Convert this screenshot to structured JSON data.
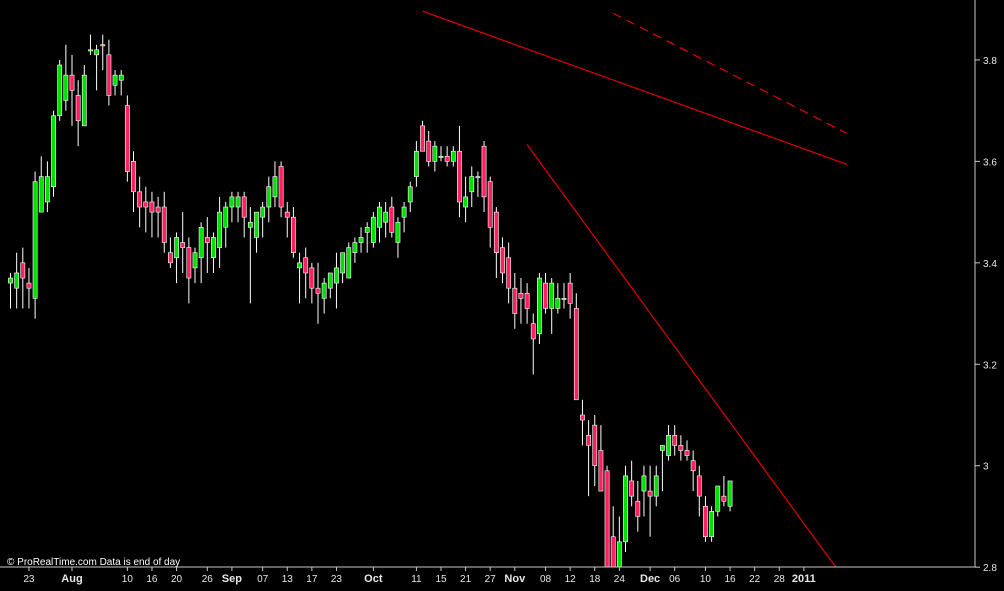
{
  "watermark": "© ProRealTime.com  Data is end of day",
  "chart_data": {
    "type": "candlestick",
    "grid": false,
    "ylim": [
      2.7,
      3.9
    ],
    "y_ticks": [
      2.8,
      3.0,
      3.2,
      3.4,
      3.6,
      3.8
    ],
    "y_tick_labels": [
      "2.8",
      "3",
      "3.2",
      "3.4",
      "3.6",
      "3.8"
    ],
    "x_ticks": [
      {
        "i": 3,
        "label": "23",
        "bold": false
      },
      {
        "i": 10,
        "label": "Aug",
        "bold": true
      },
      {
        "i": 19,
        "label": "10",
        "bold": false
      },
      {
        "i": 23,
        "label": "16",
        "bold": false
      },
      {
        "i": 27,
        "label": "20",
        "bold": false
      },
      {
        "i": 32,
        "label": "26",
        "bold": false
      },
      {
        "i": 36,
        "label": "Sep",
        "bold": true
      },
      {
        "i": 41,
        "label": "07",
        "bold": false
      },
      {
        "i": 45,
        "label": "13",
        "bold": false
      },
      {
        "i": 49,
        "label": "17",
        "bold": false
      },
      {
        "i": 53,
        "label": "23",
        "bold": false
      },
      {
        "i": 59,
        "label": "Oct",
        "bold": true
      },
      {
        "i": 66,
        "label": "11",
        "bold": false
      },
      {
        "i": 70,
        "label": "15",
        "bold": false
      },
      {
        "i": 74,
        "label": "21",
        "bold": false
      },
      {
        "i": 78,
        "label": "27",
        "bold": false
      },
      {
        "i": 82,
        "label": "Nov",
        "bold": true
      },
      {
        "i": 87,
        "label": "08",
        "bold": false
      },
      {
        "i": 91,
        "label": "12",
        "bold": false
      },
      {
        "i": 95,
        "label": "18",
        "bold": false
      },
      {
        "i": 99,
        "label": "24",
        "bold": false
      },
      {
        "i": 104,
        "label": "Dec",
        "bold": true
      },
      {
        "i": 108,
        "label": "06",
        "bold": false
      },
      {
        "i": 113,
        "label": "10",
        "bold": false
      },
      {
        "i": 117,
        "label": "16",
        "bold": false
      },
      {
        "i": 121,
        "label": "22",
        "bold": false
      },
      {
        "i": 125,
        "label": "28",
        "bold": false
      },
      {
        "i": 129,
        "label": "2011",
        "bold": true
      }
    ],
    "candles": [
      [
        3.36,
        3.38,
        3.31,
        3.37
      ],
      [
        3.35,
        3.42,
        3.31,
        3.38
      ],
      [
        3.4,
        3.43,
        3.31,
        3.37
      ],
      [
        3.36,
        3.39,
        3.31,
        3.35
      ],
      [
        3.33,
        3.58,
        3.29,
        3.56
      ],
      [
        3.5,
        3.61,
        3.5,
        3.57
      ],
      [
        3.52,
        3.6,
        3.5,
        3.57
      ],
      [
        3.55,
        3.7,
        3.53,
        3.69
      ],
      [
        3.69,
        3.8,
        3.68,
        3.79
      ],
      [
        3.72,
        3.83,
        3.7,
        3.77
      ],
      [
        3.77,
        3.81,
        3.67,
        3.74
      ],
      [
        3.73,
        3.76,
        3.63,
        3.68
      ],
      [
        3.67,
        3.79,
        3.67,
        3.77
      ],
      [
        3.82,
        3.85,
        3.81,
        3.82
      ],
      [
        3.81,
        3.83,
        3.74,
        3.82
      ],
      [
        3.83,
        3.85,
        3.78,
        3.83
      ],
      [
        3.81,
        3.84,
        3.71,
        3.73
      ],
      [
        3.75,
        3.78,
        3.73,
        3.77
      ],
      [
        3.76,
        3.78,
        3.73,
        3.77
      ],
      [
        3.71,
        3.73,
        3.56,
        3.58
      ],
      [
        3.6,
        3.62,
        3.5,
        3.54
      ],
      [
        3.54,
        3.57,
        3.47,
        3.51
      ],
      [
        3.52,
        3.55,
        3.46,
        3.51
      ],
      [
        3.52,
        3.54,
        3.45,
        3.5
      ],
      [
        3.51,
        3.53,
        3.45,
        3.5
      ],
      [
        3.51,
        3.54,
        3.42,
        3.44
      ],
      [
        3.42,
        3.45,
        3.39,
        3.4
      ],
      [
        3.41,
        3.46,
        3.36,
        3.45
      ],
      [
        3.44,
        3.5,
        3.38,
        3.43
      ],
      [
        3.43,
        3.45,
        3.32,
        3.37
      ],
      [
        3.39,
        3.43,
        3.36,
        3.42
      ],
      [
        3.41,
        3.48,
        3.36,
        3.47
      ],
      [
        3.45,
        3.49,
        3.38,
        3.44
      ],
      [
        3.41,
        3.46,
        3.38,
        3.45
      ],
      [
        3.43,
        3.53,
        3.39,
        3.5
      ],
      [
        3.47,
        3.52,
        3.43,
        3.51
      ],
      [
        3.51,
        3.54,
        3.48,
        3.53
      ],
      [
        3.51,
        3.54,
        3.48,
        3.53
      ],
      [
        3.53,
        3.54,
        3.45,
        3.49
      ],
      [
        3.47,
        3.51,
        3.32,
        3.48
      ],
      [
        3.45,
        3.5,
        3.42,
        3.5
      ],
      [
        3.49,
        3.52,
        3.45,
        3.51
      ],
      [
        3.51,
        3.57,
        3.48,
        3.55
      ],
      [
        3.53,
        3.6,
        3.51,
        3.57
      ],
      [
        3.59,
        3.6,
        3.49,
        3.51
      ],
      [
        3.5,
        3.52,
        3.45,
        3.49
      ],
      [
        3.49,
        3.51,
        3.41,
        3.42
      ],
      [
        3.39,
        3.42,
        3.32,
        3.4
      ],
      [
        3.41,
        3.43,
        3.33,
        3.38
      ],
      [
        3.39,
        3.4,
        3.32,
        3.35
      ],
      [
        3.35,
        3.4,
        3.28,
        3.34
      ],
      [
        3.33,
        3.37,
        3.3,
        3.36
      ],
      [
        3.35,
        3.38,
        3.33,
        3.38
      ],
      [
        3.36,
        3.42,
        3.31,
        3.39
      ],
      [
        3.38,
        3.42,
        3.36,
        3.42
      ],
      [
        3.37,
        3.44,
        3.37,
        3.43
      ],
      [
        3.42,
        3.45,
        3.4,
        3.44
      ],
      [
        3.44,
        3.47,
        3.42,
        3.45
      ],
      [
        3.46,
        3.48,
        3.42,
        3.47
      ],
      [
        3.44,
        3.5,
        3.43,
        3.49
      ],
      [
        3.47,
        3.52,
        3.44,
        3.51
      ],
      [
        3.48,
        3.52,
        3.45,
        3.5
      ],
      [
        3.51,
        3.53,
        3.45,
        3.46
      ],
      [
        3.44,
        3.49,
        3.41,
        3.48
      ],
      [
        3.49,
        3.52,
        3.46,
        3.51
      ],
      [
        3.52,
        3.56,
        3.5,
        3.55
      ],
      [
        3.57,
        3.64,
        3.55,
        3.62
      ],
      [
        3.67,
        3.68,
        3.62,
        3.62
      ],
      [
        3.64,
        3.66,
        3.59,
        3.6
      ],
      [
        3.6,
        3.64,
        3.58,
        3.63
      ],
      [
        3.61,
        3.63,
        3.6,
        3.61
      ],
      [
        3.61,
        3.63,
        3.59,
        3.6
      ],
      [
        3.6,
        3.63,
        3.59,
        3.62
      ],
      [
        3.62,
        3.67,
        3.49,
        3.52
      ],
      [
        3.51,
        3.57,
        3.48,
        3.53
      ],
      [
        3.54,
        3.59,
        3.51,
        3.57
      ],
      [
        3.57,
        3.58,
        3.53,
        3.57
      ],
      [
        3.63,
        3.64,
        3.5,
        3.53
      ],
      [
        3.56,
        3.57,
        3.43,
        3.47
      ],
      [
        3.5,
        3.51,
        3.37,
        3.42
      ],
      [
        3.43,
        3.45,
        3.36,
        3.38
      ],
      [
        3.41,
        3.44,
        3.32,
        3.35
      ],
      [
        3.35,
        3.38,
        3.27,
        3.3
      ],
      [
        3.34,
        3.37,
        3.28,
        3.33
      ],
      [
        3.34,
        3.36,
        3.28,
        3.31
      ],
      [
        3.28,
        3.3,
        3.18,
        3.25
      ],
      [
        3.26,
        3.38,
        3.24,
        3.37
      ],
      [
        3.36,
        3.38,
        3.3,
        3.31
      ],
      [
        3.31,
        3.37,
        3.26,
        3.36
      ],
      [
        3.31,
        3.36,
        3.3,
        3.33
      ],
      [
        3.33,
        3.36,
        3.31,
        3.33
      ],
      [
        3.36,
        3.38,
        3.29,
        3.32
      ],
      [
        3.31,
        3.34,
        3.13,
        3.13
      ],
      [
        3.1,
        3.13,
        3.04,
        3.09
      ],
      [
        3.06,
        3.09,
        2.94,
        3.04
      ],
      [
        3.08,
        3.1,
        2.96,
        3.0
      ],
      [
        3.03,
        3.08,
        2.95,
        2.95
      ],
      [
        2.99,
        3.0,
        2.75,
        2.76
      ],
      [
        2.86,
        2.92,
        2.77,
        2.78
      ],
      [
        2.77,
        2.9,
        2.75,
        2.85
      ],
      [
        2.85,
        3.0,
        2.83,
        2.98
      ],
      [
        2.97,
        3.01,
        2.92,
        2.94
      ],
      [
        2.93,
        2.97,
        2.87,
        2.9
      ],
      [
        2.95,
        3.0,
        2.9,
        2.98
      ],
      [
        2.95,
        3.0,
        2.86,
        2.94
      ],
      [
        2.94,
        3.0,
        2.92,
        2.98
      ],
      [
        3.03,
        3.04,
        2.95,
        3.04
      ],
      [
        3.02,
        3.08,
        3.01,
        3.06
      ],
      [
        3.06,
        3.08,
        3.02,
        3.04
      ],
      [
        3.04,
        3.06,
        3.01,
        3.03
      ],
      [
        3.03,
        3.05,
        3.01,
        3.02
      ],
      [
        3.01,
        3.03,
        2.95,
        2.99
      ],
      [
        2.98,
        3.0,
        2.9,
        2.94
      ],
      [
        2.92,
        2.94,
        2.85,
        2.86
      ],
      [
        2.86,
        2.92,
        2.85,
        2.91
      ],
      [
        2.91,
        2.96,
        2.9,
        2.96
      ],
      [
        2.94,
        2.98,
        2.92,
        2.93
      ],
      [
        2.92,
        2.97,
        2.91,
        2.97
      ]
    ],
    "trendlines": [
      {
        "i1": 67,
        "y1": 3.896,
        "i2": 136,
        "y2": 3.594,
        "style": "solid"
      },
      {
        "i1": 98,
        "y1": 3.892,
        "i2": 136,
        "y2": 3.655,
        "style": "dashed"
      },
      {
        "i1": 84,
        "y1": 3.633,
        "i2": 136,
        "y2": 2.77,
        "style": "solid"
      }
    ],
    "colors": {
      "up": "#00e000",
      "down": "#ff2060",
      "wick": "#ffffff",
      "trendline": "#e00000",
      "axis": "#c8c8c8",
      "background": "#000000"
    }
  }
}
